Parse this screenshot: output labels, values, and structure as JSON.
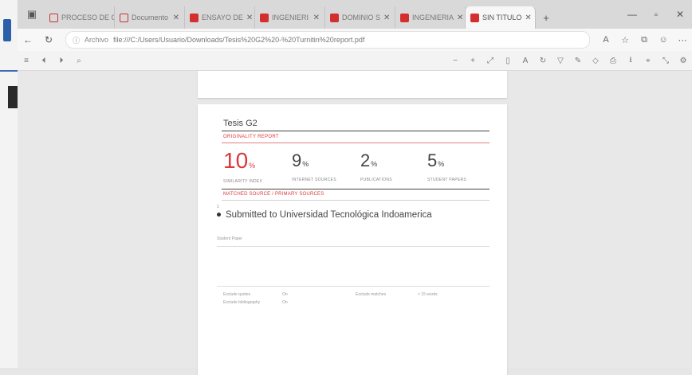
{
  "browser": {
    "tabs": [
      {
        "label": "PROCESO DE C",
        "active": false
      },
      {
        "label": "Documento",
        "active": false
      },
      {
        "label": "ENSAYO DE",
        "active": false
      },
      {
        "label": "INGENIERI",
        "active": false
      },
      {
        "label": "DOMINIO S",
        "active": false
      },
      {
        "label": "INGENIERIA",
        "active": false
      },
      {
        "label": "SIN TITULO",
        "active": true
      }
    ],
    "new_tab": "+",
    "url_prefix": "Archivo",
    "url": "file:///C:/Users/Usuario/Downloads/Tesis%20G2%20-%20Turnitin%20report.pdf"
  },
  "report": {
    "title": "Tesis G2",
    "originality_label": "ORIGINALITY REPORT",
    "stats": [
      {
        "value": "10",
        "unit": "%",
        "label": "SIMILARITY INDEX",
        "highlight": true
      },
      {
        "value": "9",
        "unit": "%",
        "label": "INTERNET SOURCES",
        "highlight": false
      },
      {
        "value": "2",
        "unit": "%",
        "label": "PUBLICATIONS",
        "highlight": false
      },
      {
        "value": "5",
        "unit": "%",
        "label": "STUDENT PAPERS",
        "highlight": false
      }
    ],
    "match_label": "MATCHED SOURCE / PRIMARY SOURCES",
    "source_number": "1",
    "source_text": "Submitted to Universidad Tecnológica Indoamerica",
    "source_type": "Student Paper",
    "meta": {
      "exclude_quotes_label": "Exclude quotes",
      "exclude_quotes_value": "On",
      "exclude_bib_label": "Exclude bibliography",
      "exclude_bib_value": "On",
      "exclude_matches_label": "Exclude matches",
      "exclude_matches_value": "< 15 words"
    }
  }
}
